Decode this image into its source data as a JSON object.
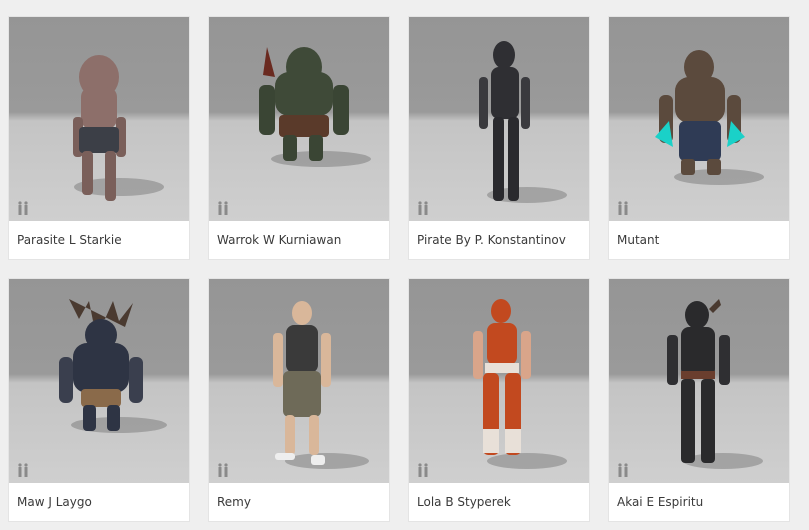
{
  "characters": [
    {
      "name": "Parasite L Starkie",
      "icon": "character-figure-icon",
      "tone": "#8d6f6a",
      "accent": "#3c3f47"
    },
    {
      "name": "Warrok W Kurniawan",
      "icon": "character-figure-icon",
      "tone": "#3f4a38",
      "accent": "#5a3a2a"
    },
    {
      "name": "Pirate By P. Konstantinov",
      "icon": "character-figure-icon",
      "tone": "#2f2f33",
      "accent": "#5a5a5e"
    },
    {
      "name": "Mutant",
      "icon": "character-figure-icon",
      "tone": "#5b4a3d",
      "accent": "#1ad1c8"
    },
    {
      "name": "Maw J Laygo",
      "icon": "character-figure-icon",
      "tone": "#2e3444",
      "accent": "#8a6a4a"
    },
    {
      "name": "Remy",
      "icon": "character-figure-icon",
      "tone": "#3a3a3a",
      "accent": "#6e6a58"
    },
    {
      "name": "Lola B Styperek",
      "icon": "character-figure-icon",
      "tone": "#c2491f",
      "accent": "#e8e0d8"
    },
    {
      "name": "Akai E Espiritu",
      "icon": "character-figure-icon",
      "tone": "#2a2a2c",
      "accent": "#6a3e2e"
    }
  ]
}
